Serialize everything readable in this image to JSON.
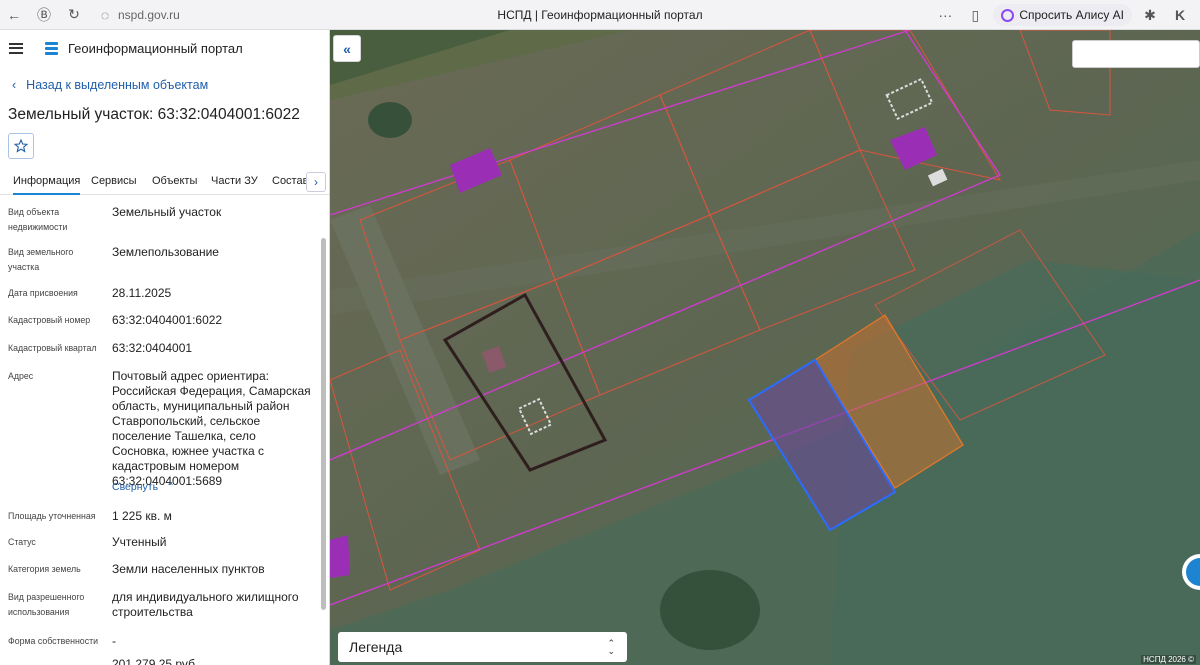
{
  "browser": {
    "url": "nspd.gov.ru",
    "tab_title": "НСПД | Геоинформационный портал",
    "alisa_label": "Спросить Алису AI",
    "more_label": "···"
  },
  "header": {
    "app_name": "Геоинформационный портал"
  },
  "back_link": "Назад к выделенным объектам",
  "object_title": "Земельный участок: 63:32:0404001:6022",
  "tabs": [
    "Информация",
    "Сервисы",
    "Объекты",
    "Части ЗУ",
    "Состав"
  ],
  "properties": [
    {
      "label": "Вид объекта недвижимости",
      "value": "Земельный участок"
    },
    {
      "label": "Вид земельного участка",
      "value": "Землепользование"
    },
    {
      "label": "Дата присвоения",
      "value": "28.11.2025"
    },
    {
      "label": "Кадастровый номер",
      "value": "63:32:0404001:6022"
    },
    {
      "label": "Кадастровый квартал",
      "value": "63:32:0404001"
    },
    {
      "label": "Адрес",
      "value": "Почтовый адрес ориентира: Российская Федерация, Самарская область, муниципальный район Ставропольский, сельское поселение Ташелка, село Сосновка, южнее участка с кадастровым номером 63:32:0404001:5689"
    },
    {
      "label": "Площадь уточненная",
      "value": "1 225 кв. м"
    },
    {
      "label": "Статус",
      "value": "Учтенный"
    },
    {
      "label": "Категория земель",
      "value": "Земли населенных пунктов"
    },
    {
      "label": "Вид разрешенного использования",
      "value": "для индивидуального жилищного строительства"
    },
    {
      "label": "Форма собственности",
      "value": "-"
    },
    {
      "label": "",
      "value": "201 279,25 руб."
    }
  ],
  "collapse_label": "Свернуть",
  "map": {
    "legend_label": "Легенда",
    "copyright": "НСПД 2026 ©",
    "colors": {
      "selected_parcel": "#2b6cff",
      "neighbor_parcel": "#e0782a",
      "boundary_magenta": "#d23ad2",
      "parcel_red": "#d8553e"
    }
  }
}
